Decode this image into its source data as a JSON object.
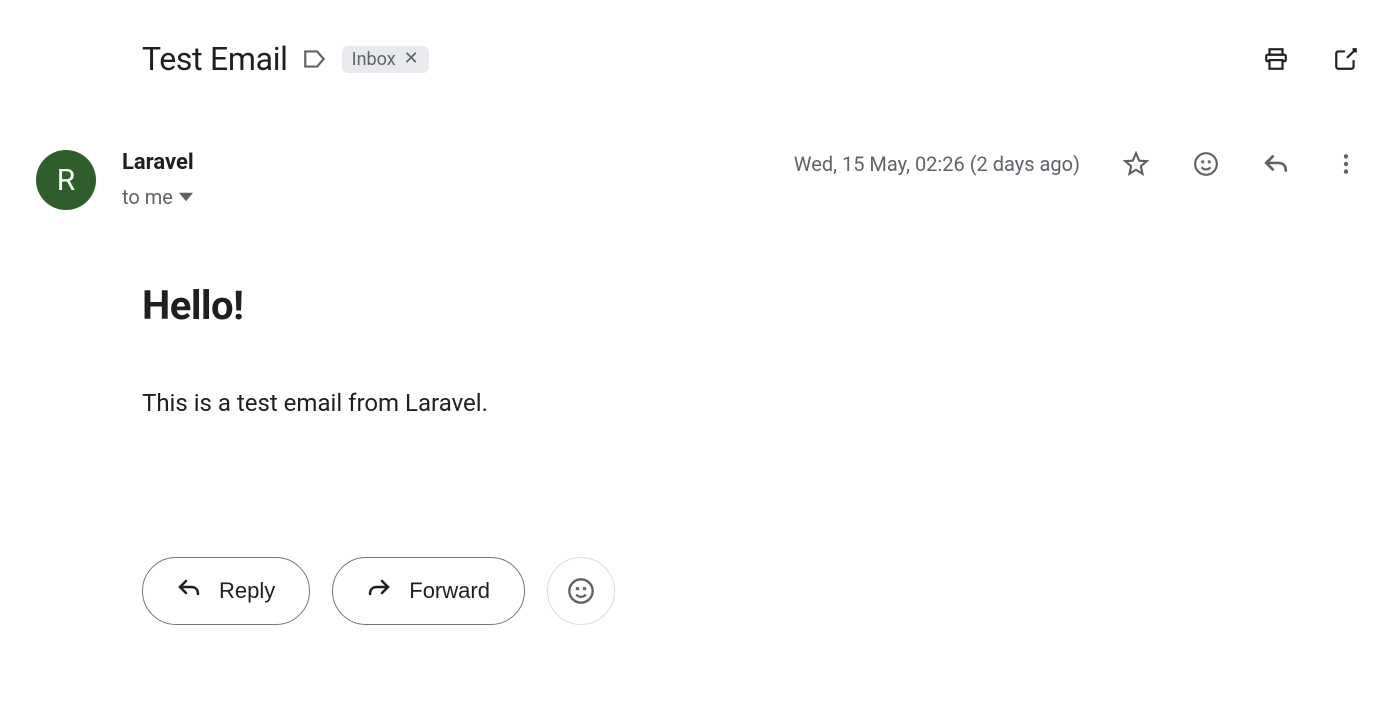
{
  "subject": "Test Email",
  "labels": {
    "inbox": "Inbox"
  },
  "avatar_letter": "R",
  "sender": {
    "name": "Laravel"
  },
  "recipient_line": "to me",
  "timestamp": "Wed, 15 May, 02:26 (2 days ago)",
  "body": {
    "heading": "Hello!",
    "text": "This is a test email from Laravel."
  },
  "actions": {
    "reply": "Reply",
    "forward": "Forward"
  }
}
